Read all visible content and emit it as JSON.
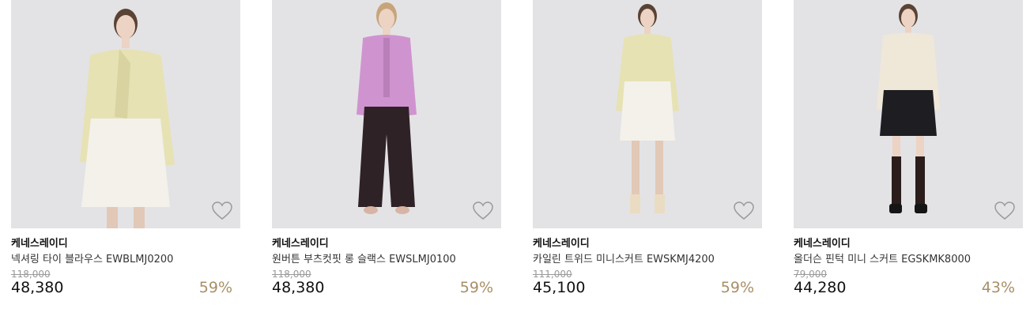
{
  "products": [
    {
      "brand": "케네스레이디",
      "name": "넥셔링 타이 블라우스 EWBLMJ0200",
      "original_price": "118,000",
      "price": "48,380",
      "discount": "59%",
      "wishlist_icon": "heart-outline-icon",
      "colors": {
        "top": "#e6e2b4",
        "bottom": "#f3f1ea",
        "legs": "#e2c8b7",
        "shoes": "#efe7dc"
      }
    },
    {
      "brand": "케네스레이디",
      "name": "원버튼 부츠컷핏 롱 슬랙스 EWSLMJ0100",
      "original_price": "118,000",
      "price": "48,380",
      "discount": "59%",
      "wishlist_icon": "heart-outline-icon",
      "colors": {
        "top": "#cf94cf",
        "bottom": "#2f2226",
        "legs": "#2f2226",
        "shoes": "#d7b4a4"
      }
    },
    {
      "brand": "케네스레이디",
      "name": "카일린 트위드 미니스커트 EWSKMJ4200",
      "original_price": "111,000",
      "price": "45,100",
      "discount": "59%",
      "wishlist_icon": "heart-outline-icon",
      "colors": {
        "top": "#e6e2b4",
        "bottom": "#f3f1ea",
        "legs": "#e2c8b7",
        "shoes": "#e9dcc2"
      }
    },
    {
      "brand": "케네스레이디",
      "name": "올더슨 핀턱 미니 스커트 EGSKMK8000",
      "original_price": "79,000",
      "price": "44,280",
      "discount": "43%",
      "wishlist_icon": "heart-outline-icon",
      "colors": {
        "top": "#efe8d9",
        "bottom": "#1d1d22",
        "legs": "#2a1d1c",
        "shoes": "#151515"
      }
    }
  ],
  "accent_color": "#a88f66"
}
